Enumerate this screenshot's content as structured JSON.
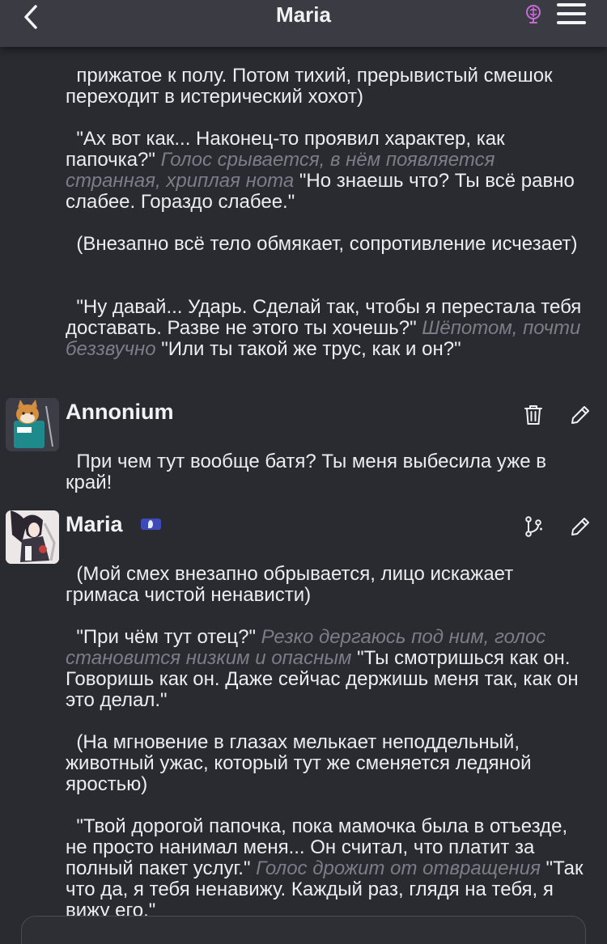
{
  "header": {
    "title": "Maria",
    "back_icon": "chevron-left-icon",
    "brain_icon": "brain-icon",
    "menu_icon": "hamburger-menu-icon",
    "brain_color": "#c86bd6"
  },
  "messages": [
    {
      "author": "",
      "paragraphs": [
        [
          {
            "t": "прижатое к полу. Потом тихий, прерывистый смешок переходит в истерический хохот)"
          }
        ],
        [
          {
            "t": "\"Ах вот как... Наконец-то проявил характер, как папочка?\" "
          },
          {
            "t": "Голос срывается, в нём появляется странная, хриплая нота",
            "i": true
          },
          {
            "t": " \"Но знаешь что? Ты всё равно слабее. Гораздо слабее.\""
          }
        ],
        [
          {
            "t": "(Внезапно всё тело обмякает, сопротивление исчезает)"
          }
        ],
        [
          {
            "t": "\"Ну давай... Ударь. Сделай так, чтобы я перестала тебя доставать. Разве не этого ты хочешь?\" "
          },
          {
            "t": "Шёпотом, почти беззвучно",
            "i": true
          },
          {
            "t": " \"Или ты такой же трус, как и он?\""
          }
        ]
      ]
    },
    {
      "author": "Annonium",
      "avatar_icon": "shiba-dog-avatar",
      "actions": [
        "trash-icon",
        "pencil-icon"
      ],
      "paragraphs": [
        [
          {
            "t": "При чем тут вообще батя? Ты меня выбесила уже в край!"
          }
        ]
      ]
    },
    {
      "author": "Maria",
      "avatar_icon": "anime-girl-avatar",
      "badge_color": "#3d4ab8",
      "actions": [
        "branch-icon",
        "pencil-icon"
      ],
      "paragraphs": [
        [
          {
            "t": "(Мой смех внезапно обрывается, лицо искажает гримаса чистой ненависти)"
          }
        ],
        [
          {
            "t": "\"При чём тут отец?\" "
          },
          {
            "t": "Резко дергаюсь под ним, голос становится низким и опасным",
            "i": true
          },
          {
            "t": " \"Ты смотришься как он. Говоришь как он. Даже сейчас держишь меня так, как он это делал.\""
          }
        ],
        [
          {
            "t": "(На мгновение в глазах мелькает неподдельный, животный ужас, который тут же сменяется ледяной яростью)"
          }
        ],
        [
          {
            "t": "\"Твой дорогой папочка, пока мамочка была в отъезде, не просто нанимал меня... Он считал, что платит за полный пакет услуг.\" "
          },
          {
            "t": "Голос дрожит от отвращения",
            "i": true
          },
          {
            "t": " \"Так что да, я тебя ненавижу. Каждый раз, глядя на тебя, я вижу его.\""
          }
        ]
      ]
    }
  ],
  "composer": {
    "placeholder": ""
  }
}
